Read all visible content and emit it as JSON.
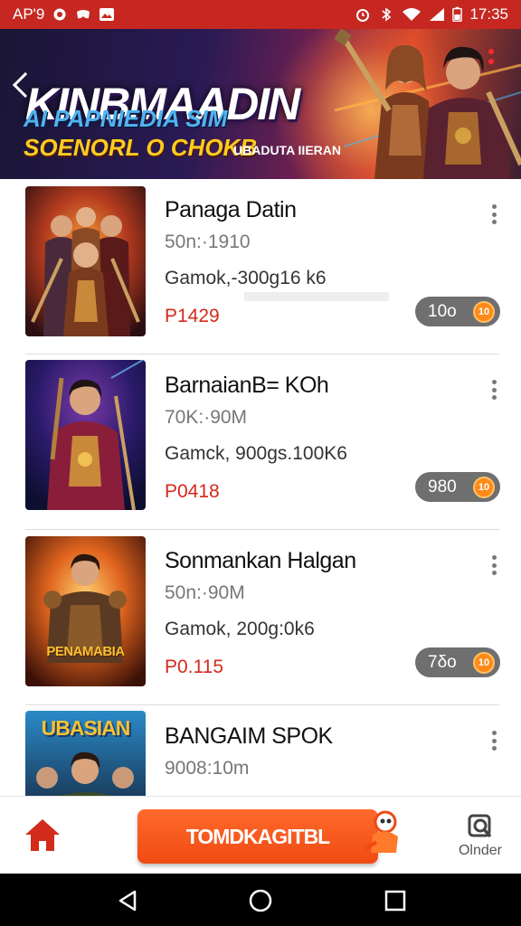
{
  "status_bar": {
    "left_text": "AP'9",
    "time": "17:35",
    "icons": [
      "record-icon",
      "game-icon",
      "image-icon",
      "alarm-icon",
      "bluetooth-icon",
      "wifi-icon",
      "signal-icon",
      "battery-icon"
    ]
  },
  "banner": {
    "title": "KINBMAADIN",
    "subtitle_1": "AI PAPNIEDIA SIM",
    "subtitle_2": "SOENORL O CHOKB",
    "tag": "UBADUTA IIERAN",
    "colors": {
      "title": "#ffffff",
      "subtitle_1": "#4fb4f0",
      "subtitle_2": "#ffcc1f"
    }
  },
  "list": {
    "items": [
      {
        "title": "Panaga Datin",
        "meta": "50n:·1910",
        "desc": "Gamok,-300g16 k6",
        "price": "P1429",
        "badge": "10o",
        "coin": "10",
        "thumb_caption": ""
      },
      {
        "title": "BarnaianB= KOh",
        "meta": "70K:·90M",
        "desc": "Gamck, 900gs.100K6",
        "price": "P0418",
        "badge": "980",
        "coin": "10",
        "thumb_caption": ""
      },
      {
        "title": "Sonmankan Halgan",
        "meta": "50n:·90M",
        "desc": "Gamok, 200g:0k6",
        "price": "P0.115",
        "badge": "7δo",
        "coin": "10",
        "thumb_caption": "PENAMABIA"
      },
      {
        "title": "BANGAIM SPOK",
        "meta": "9008:10m",
        "desc": "",
        "price": "",
        "badge": "",
        "coin": "",
        "thumb_caption": "UBASIAN"
      }
    ]
  },
  "bottom_bar": {
    "primary_button": "TOMDKAGITBL",
    "order_label": "Olnder",
    "accent": "#ef4a12"
  },
  "nav_bar": {
    "icons": [
      "back-icon",
      "home-circle-icon",
      "recents-icon"
    ]
  }
}
